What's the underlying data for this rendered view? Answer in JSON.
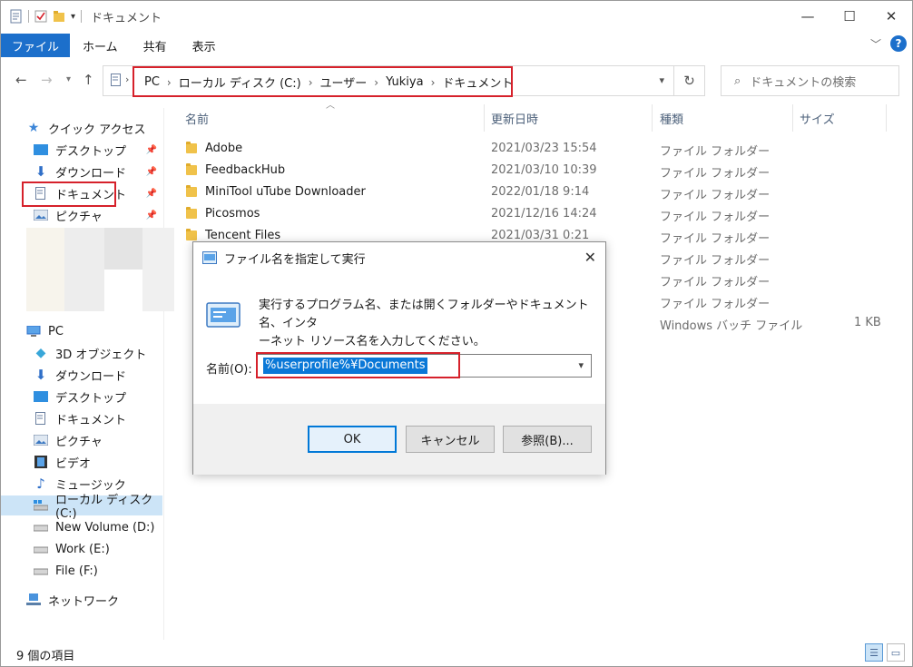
{
  "window": {
    "title": "ドキュメント",
    "controls": {
      "minimize": "—",
      "maximize": "☐",
      "close": "✕"
    }
  },
  "ribbon": {
    "tabs": [
      "ファイル",
      "ホーム",
      "共有",
      "表示"
    ],
    "expand_icon": "chevron-down-icon",
    "help_label": "?"
  },
  "address": {
    "crumbs": [
      "PC",
      "ローカル ディスク (C:)",
      "ユーザー",
      "Yukiya",
      "ドキュメント"
    ],
    "separator": "›",
    "search_placeholder": "ドキュメントの検索"
  },
  "sidebar": {
    "quick_access": "クイック アクセス",
    "quick_items": [
      "デスクトップ",
      "ダウンロード",
      "ドキュメント",
      "ピクチャ"
    ],
    "pc": "PC",
    "pc_items": [
      "3D オブジェクト",
      "ダウンロード",
      "デスクトップ",
      "ドキュメント",
      "ピクチャ",
      "ビデオ",
      "ミュージック",
      "ローカル ディスク (C:)",
      "New Volume (D:)",
      "Work (E:)",
      "File (F:)"
    ],
    "network": "ネットワーク"
  },
  "columns": {
    "name": "名前",
    "modified": "更新日時",
    "type": "種類",
    "size": "サイズ"
  },
  "files": [
    {
      "name": "Adobe",
      "modified": "2021/03/23 15:54",
      "type": "ファイル フォルダー",
      "size": ""
    },
    {
      "name": "FeedbackHub",
      "modified": "2021/03/10 10:39",
      "type": "ファイル フォルダー",
      "size": ""
    },
    {
      "name": "MiniTool uTube Downloader",
      "modified": "2022/01/18 9:14",
      "type": "ファイル フォルダー",
      "size": ""
    },
    {
      "name": "Picosmos",
      "modified": "2021/12/16 14:24",
      "type": "ファイル フォルダー",
      "size": ""
    },
    {
      "name": "Tencent Files",
      "modified": "2021/03/31 0:21",
      "type": "ファイル フォルダー",
      "size": ""
    },
    {
      "name": "",
      "modified": "",
      "type": "ファイル フォルダー",
      "size": ""
    },
    {
      "name": "",
      "modified": "",
      "type": "ファイル フォルダー",
      "size": ""
    },
    {
      "name": "",
      "modified": "",
      "type": "ファイル フォルダー",
      "size": ""
    },
    {
      "name": "",
      "modified": "",
      "type": "Windows バッチ ファイル",
      "size": "1 KB"
    }
  ],
  "status": {
    "count": "9 個の項目"
  },
  "dialog": {
    "title": "ファイル名を指定して実行",
    "desc_line1": "実行するプログラム名、または開くフォルダーやドキュメント名、インタ",
    "desc_line2": "ーネット リソース名を入力してください。",
    "label": "名前(O):",
    "value": "%userprofile%¥Documents",
    "ok": "OK",
    "cancel": "キャンセル",
    "browse": "参照(B)..."
  },
  "colors": {
    "accent": "#1c6fcb",
    "highlight_border": "#d6212b",
    "selection": "#0a78d7"
  }
}
